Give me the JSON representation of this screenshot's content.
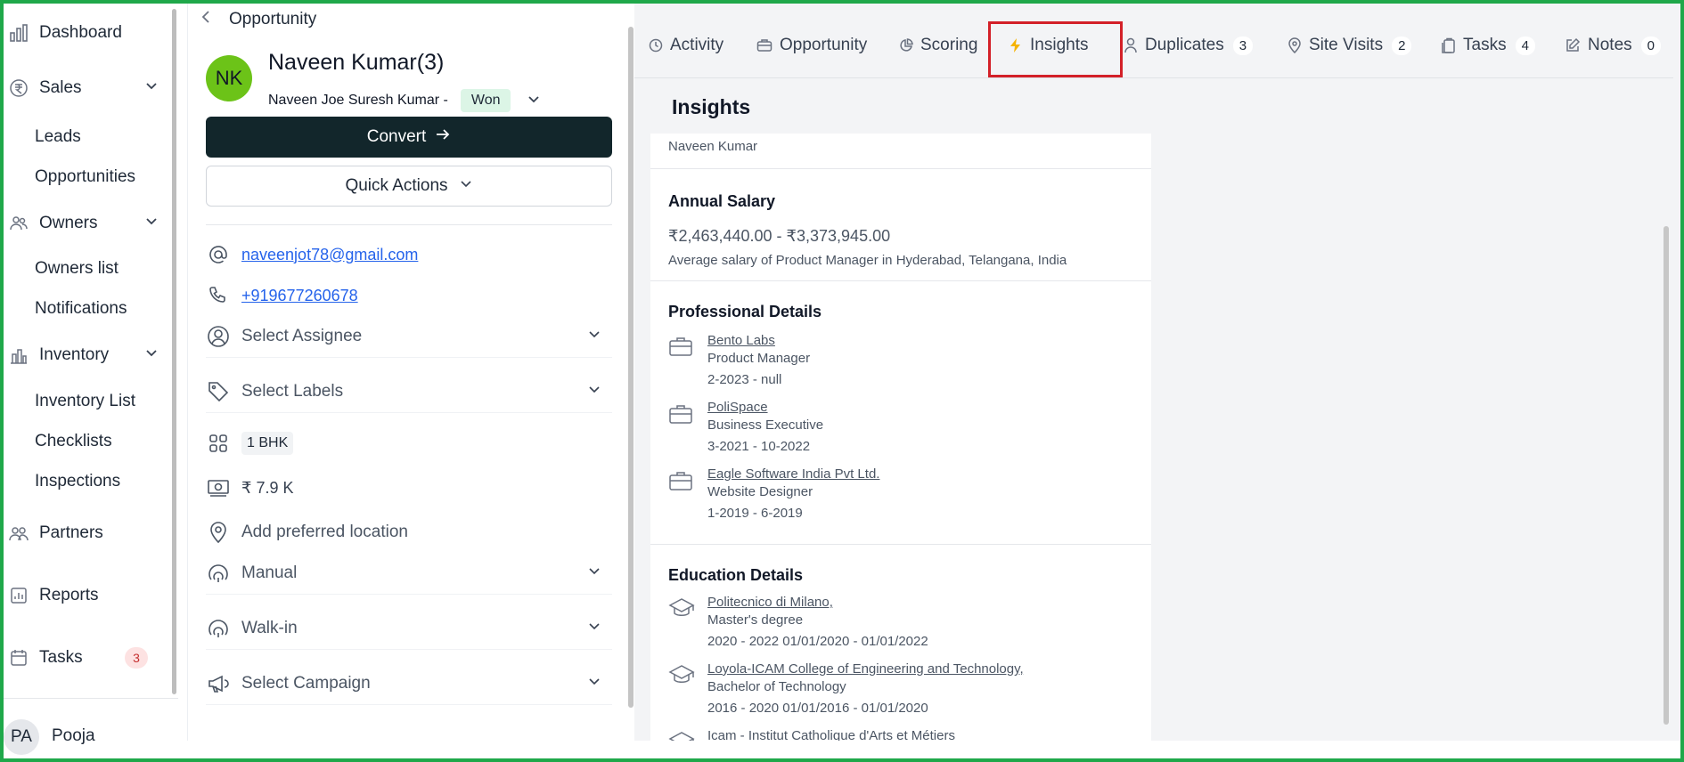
{
  "sidebar": {
    "items": [
      {
        "label": "Dashboard"
      },
      {
        "label": "Sales"
      },
      {
        "label": "Leads"
      },
      {
        "label": "Opportunities"
      },
      {
        "label": "Owners"
      },
      {
        "label": "Owners list"
      },
      {
        "label": "Notifications"
      },
      {
        "label": "Inventory"
      },
      {
        "label": "Inventory List"
      },
      {
        "label": "Checklists"
      },
      {
        "label": "Inspections"
      },
      {
        "label": "Partners"
      },
      {
        "label": "Reports"
      },
      {
        "label": "Tasks",
        "badge": "3"
      }
    ],
    "user": {
      "initials": "PA",
      "name": "Pooja"
    }
  },
  "opportunity": {
    "breadcrumb": "Opportunity",
    "avatar_initials": "NK",
    "name": "Naveen Kumar(3)",
    "subname": "Naveen Joe Suresh Kumar  -",
    "status": "Won",
    "convert_label": "Convert",
    "quick_actions_label": "Quick Actions",
    "email": "naveenjot78@gmail.com",
    "phone": "+919677260678",
    "assignee_placeholder": "Select Assignee",
    "labels_placeholder": "Select Labels",
    "unit_type": "1 BHK",
    "budget": "₹ 7.9 K",
    "location_placeholder": "Add preferred location",
    "source": "Manual",
    "sub_source": "Walk-in",
    "campaign_placeholder": "Select Campaign"
  },
  "tabs": [
    {
      "label": "Activity"
    },
    {
      "label": "Opportunity"
    },
    {
      "label": "Scoring"
    },
    {
      "label": "Insights"
    },
    {
      "label": "Duplicates",
      "count": "3"
    },
    {
      "label": "Site Visits",
      "count": "2"
    },
    {
      "label": "Tasks",
      "count": "4"
    },
    {
      "label": "Notes",
      "count": "0"
    }
  ],
  "insights": {
    "title": "Insights",
    "top_name": "Naveen  Kumar",
    "salary": {
      "title": "Annual Salary",
      "range": "₹2,463,440.00 - ₹3,373,945.00",
      "note": "Average salary of Product Manager in Hyderabad, Telangana, India"
    },
    "professional": {
      "title": "Professional Details",
      "entries": [
        {
          "company": "Bento Labs",
          "role": "Product Manager",
          "period": "2-2023 - null"
        },
        {
          "company": "PoliSpace",
          "role": "Business Executive",
          "period": "3-2021 - 10-2022"
        },
        {
          "company": "Eagle Software India Pvt Ltd.",
          "role": "Website Designer",
          "period": "1-2019 - 6-2019"
        }
      ]
    },
    "education": {
      "title": "Education Details",
      "entries": [
        {
          "school": "Politecnico di Milano,",
          "degree": "Master's degree",
          "period": "2020 - 2022 01/01/2020 - 01/01/2022"
        },
        {
          "school": "Loyola-ICAM College of Engineering and Technology,",
          "degree": "Bachelor of Technology",
          "period": "2016 - 2020 01/01/2016 - 01/01/2020"
        },
        {
          "school": "Icam - Institut Catholique d'Arts et Métiers"
        }
      ]
    }
  },
  "colors": {
    "frame": "#1fa84a",
    "convert_bg": "#12262b",
    "avatar_green": "#6cc318",
    "won_bg": "#dcf5e6",
    "highlight": "#d32028",
    "link": "#2563eb"
  }
}
